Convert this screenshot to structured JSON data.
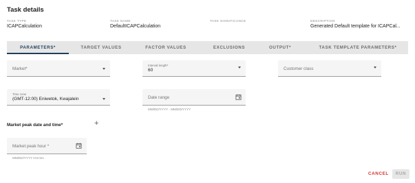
{
  "page": {
    "title": "Task details"
  },
  "meta": {
    "task_type": {
      "label": "TASK TYPE",
      "value": "ICAPCalculation"
    },
    "task_name": {
      "label": "TASK NAME",
      "value": "DefaultICAPCalculation"
    },
    "task_significance": {
      "label": "TASK SIGNIFICANCE",
      "value": ""
    },
    "description": {
      "label": "DESCRIPTION",
      "value": "Generated Default template for ICAPCal..."
    }
  },
  "tabs": [
    {
      "label": "PARAMETERS*",
      "active": true
    },
    {
      "label": "TARGET VALUES"
    },
    {
      "label": "FACTOR VALUES"
    },
    {
      "label": "EXCLUSIONS"
    },
    {
      "label": "OUTPUT*"
    },
    {
      "label": "TASK TEMPLATE PARAMETERS*"
    }
  ],
  "form": {
    "market": {
      "placeholder": "Market*"
    },
    "interval_length": {
      "label": "Interval length*",
      "value": "60"
    },
    "customer_class": {
      "placeholder": "Customer class"
    },
    "time_zone": {
      "label": "Time zone",
      "value": "(GMT-12:00) Eniwetok, Kwajalein"
    },
    "date_range": {
      "placeholder": "Date range",
      "hint": "MM/DD/YYYY - MM/DD/YYYY"
    },
    "market_peak": {
      "section_label": "Market peak date and time*",
      "add_symbol": "+",
      "placeholder": "Market peak hour *",
      "hint": "MM/DD/YYYY HH:mm"
    }
  },
  "actions": {
    "cancel": "CANCEL",
    "run": "RUN"
  },
  "icons": {
    "dropdown": "chevron-down-icon",
    "calendar": "calendar-icon",
    "add": "plus-icon"
  },
  "colors": {
    "accent": "#1e3e5c",
    "cancel": "#d32f2f",
    "tab_bar": "#e6e6e6"
  }
}
